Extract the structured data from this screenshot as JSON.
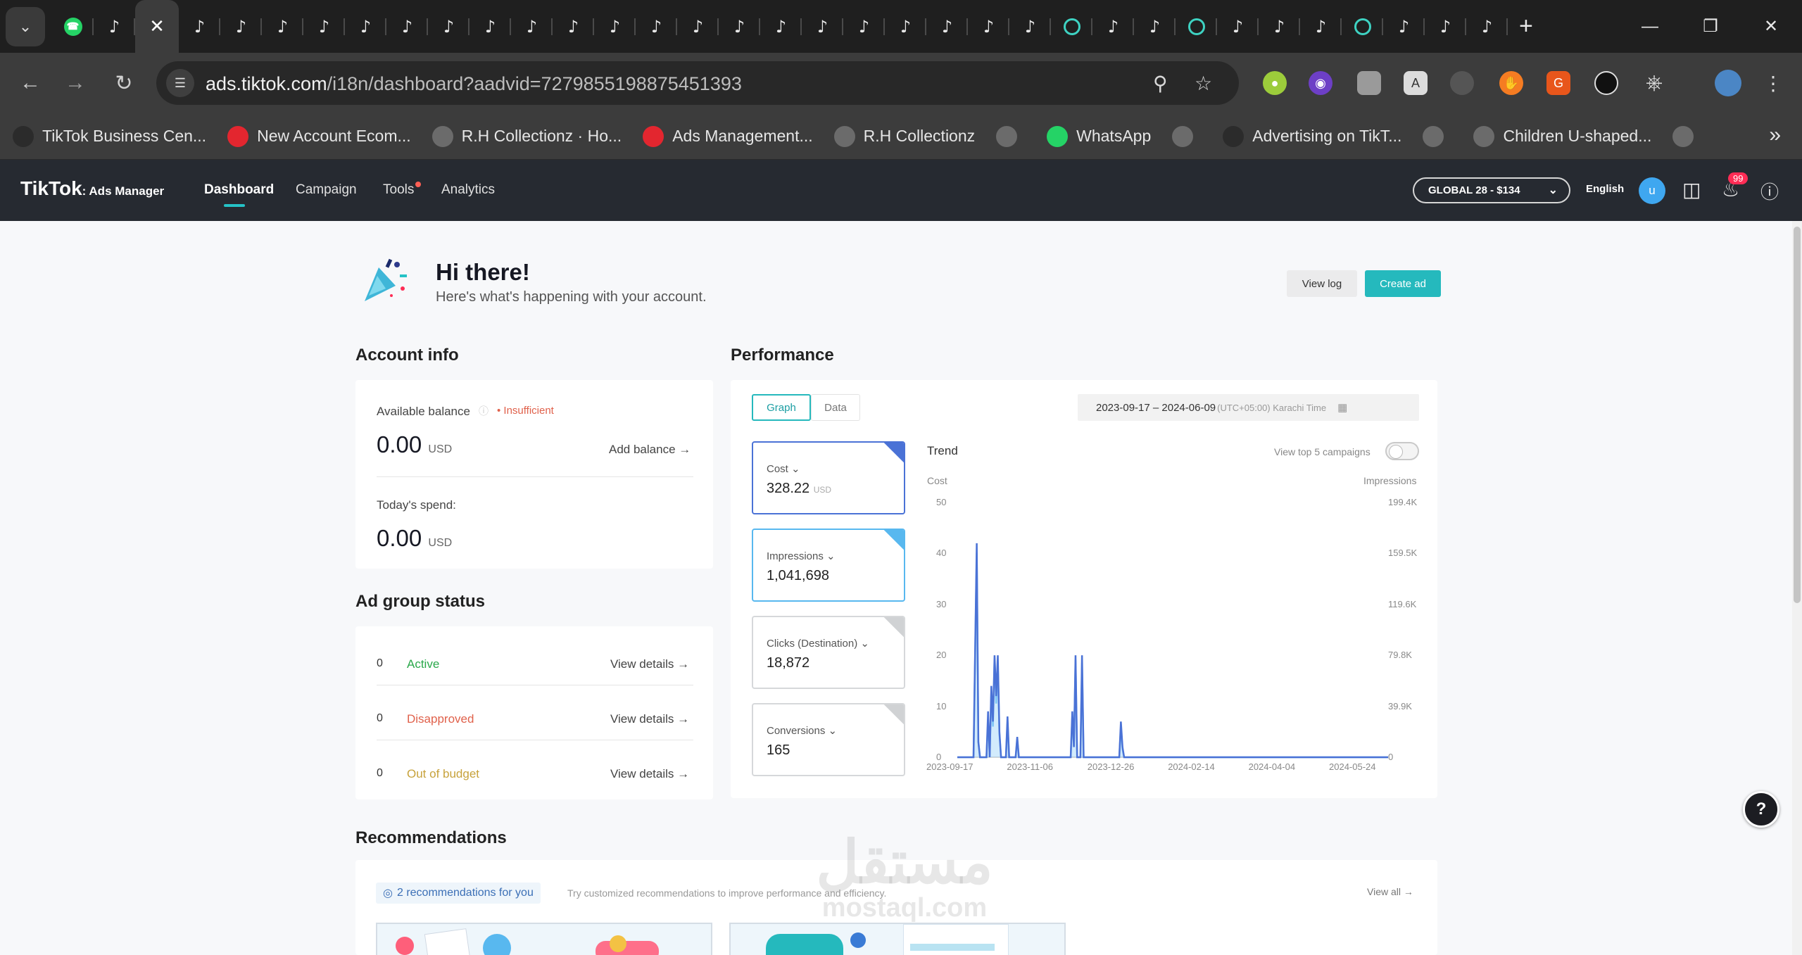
{
  "browser": {
    "tabs": [
      "whatsapp",
      "tiktok",
      "close",
      "tiktok",
      "tiktok",
      "tiktok",
      "tiktok",
      "tiktok",
      "tiktok",
      "tiktok",
      "tiktok",
      "tiktok",
      "tiktok",
      "tiktok",
      "tiktok",
      "tiktok",
      "tiktok",
      "tiktok",
      "tiktok",
      "tiktok",
      "tiktok",
      "tiktok",
      "tiktok",
      "tiktok",
      "loading",
      "tiktok",
      "tiktok",
      "loading",
      "tiktok",
      "tiktok",
      "tiktok",
      "loading",
      "tiktok",
      "tiktok",
      "tiktok"
    ],
    "url_host": "ads.tiktok.com",
    "url_path": "/i18n/dashboard?aadvid=7279855198875451393",
    "bookmarks": [
      {
        "label": "TikTok Business Cen...",
        "icon": "tiktok-icon",
        "color": "#2b2b2b"
      },
      {
        "label": "New Account Ecom...",
        "icon": "target-icon",
        "color": "#e3262f"
      },
      {
        "label": "R.H Collectionz · Ho...",
        "icon": "globe-icon",
        "color": "#6b6b6b"
      },
      {
        "label": "Ads Management...",
        "icon": "target-icon",
        "color": "#e3262f"
      },
      {
        "label": "R.H Collectionz",
        "icon": "globe-icon",
        "color": "#6b6b6b"
      },
      {
        "label": "",
        "icon": "globe-icon",
        "color": "#6b6b6b"
      },
      {
        "label": "WhatsApp",
        "icon": "whatsapp-icon",
        "color": "#25d366"
      },
      {
        "label": "",
        "icon": "globe-icon",
        "color": "#6b6b6b"
      },
      {
        "label": "Advertising on TikT...",
        "icon": "tiktok-icon",
        "color": "#2b2b2b"
      },
      {
        "label": "",
        "icon": "globe-icon",
        "color": "#6b6b6b"
      },
      {
        "label": "Children U-shaped...",
        "icon": "globe-icon",
        "color": "#6b6b6b"
      },
      {
        "label": "",
        "icon": "globe-icon",
        "color": "#6b6b6b"
      }
    ]
  },
  "header": {
    "logo": "TikTok",
    "logo_sub": ": Ads Manager",
    "nav": [
      "Dashboard",
      "Campaign",
      "Tools",
      "Analytics"
    ],
    "account": "GLOBAL 28 - $134",
    "language": "English",
    "avatar": "u",
    "notification_count": "99"
  },
  "greeting": {
    "title": "Hi there!",
    "subtitle": "Here's what's happening with your account.",
    "view_log": "View log",
    "create_ad": "Create ad"
  },
  "account_info": {
    "title": "Account info",
    "balance_label": "Available balance",
    "insufficient": "• Insufficient",
    "balance": "0.00",
    "currency": "USD",
    "add_balance": "Add balance →",
    "spend_label": "Today's spend:",
    "spend": "0.00"
  },
  "ad_group_status": {
    "title": "Ad group status",
    "rows": [
      {
        "count": "0",
        "label": "Active",
        "color": "#2aa84a",
        "link": "View details →"
      },
      {
        "count": "0",
        "label": "Disapproved",
        "color": "#e0614b",
        "link": "View details →"
      },
      {
        "count": "0",
        "label": "Out of budget",
        "color": "#c7a23b",
        "link": "View details →"
      }
    ]
  },
  "performance": {
    "title": "Performance",
    "tab_graph": "Graph",
    "tab_data": "Data",
    "date_range": "2023-09-17   –   2024-06-09",
    "timezone": "(UTC+05:00) Karachi Time",
    "metrics": [
      {
        "label": "Cost ⌄",
        "value": "328.22",
        "unit": "USD",
        "accent": "#4a72d6"
      },
      {
        "label": "Impressions ⌄",
        "value": "1,041,698",
        "unit": "",
        "accent": "#58b8ef"
      },
      {
        "label": "Clicks (Destination) ⌄",
        "value": "18,872",
        "unit": "",
        "accent": "#d0d2d4"
      },
      {
        "label": "Conversions ⌄",
        "value": "165",
        "unit": "",
        "accent": "#d0d2d4"
      }
    ],
    "trend_title": "Trend",
    "toggle_label": "View top 5 campaigns"
  },
  "chart_data": {
    "type": "line",
    "xlabel": "",
    "y_left_label": "Cost",
    "y_right_label": "Impressions",
    "x_ticks": [
      "2023-09-17",
      "2023-11-06",
      "2023-12-26",
      "2024-02-14",
      "2024-04-04",
      "2024-05-24"
    ],
    "y_left_ticks": [
      "50",
      "40",
      "30",
      "20",
      "10",
      "0"
    ],
    "y_right_ticks": [
      "199.4K",
      "159.5K",
      "119.6K",
      "79.8K",
      "39.9K",
      "0"
    ],
    "ylim_left": [
      0,
      50
    ],
    "ylim_right": [
      0,
      199400
    ],
    "x_day_range": [
      0,
      266
    ],
    "series": [
      {
        "name": "Cost",
        "color": "#4a72d6",
        "points": [
          [
            0,
            0
          ],
          [
            10,
            0
          ],
          [
            12,
            42
          ],
          [
            13,
            3
          ],
          [
            14,
            0
          ],
          [
            18,
            0
          ],
          [
            19,
            9
          ],
          [
            20,
            0
          ],
          [
            21,
            14
          ],
          [
            22,
            7
          ],
          [
            23,
            20
          ],
          [
            24,
            12
          ],
          [
            25,
            20
          ],
          [
            26,
            5
          ],
          [
            27,
            0
          ],
          [
            30,
            0
          ],
          [
            31,
            8
          ],
          [
            32,
            0
          ],
          [
            36,
            0
          ],
          [
            37,
            4
          ],
          [
            38,
            0
          ],
          [
            70,
            0
          ],
          [
            71,
            9
          ],
          [
            72,
            2
          ],
          [
            73,
            20
          ],
          [
            74,
            0
          ],
          [
            76,
            0
          ],
          [
            77,
            20
          ],
          [
            78,
            0
          ],
          [
            100,
            0
          ],
          [
            101,
            7
          ],
          [
            102,
            2
          ],
          [
            103,
            0
          ],
          [
            266,
            0
          ]
        ]
      },
      {
        "name": "Impressions",
        "color": "#7fc6f5",
        "points": [
          [
            0,
            0
          ],
          [
            10,
            0
          ],
          [
            12,
            160000
          ],
          [
            13,
            12000
          ],
          [
            14,
            0
          ],
          [
            18,
            0
          ],
          [
            19,
            30000
          ],
          [
            20,
            0
          ],
          [
            21,
            52000
          ],
          [
            22,
            24000
          ],
          [
            23,
            78000
          ],
          [
            24,
            42000
          ],
          [
            25,
            74000
          ],
          [
            26,
            18000
          ],
          [
            27,
            0
          ],
          [
            30,
            0
          ],
          [
            31,
            28000
          ],
          [
            32,
            0
          ],
          [
            36,
            0
          ],
          [
            37,
            14000
          ],
          [
            38,
            0
          ],
          [
            70,
            0
          ],
          [
            71,
            32000
          ],
          [
            72,
            8000
          ],
          [
            73,
            76000
          ],
          [
            74,
            0
          ],
          [
            76,
            0
          ],
          [
            77,
            74000
          ],
          [
            78,
            0
          ],
          [
            100,
            0
          ],
          [
            101,
            24000
          ],
          [
            102,
            6000
          ],
          [
            103,
            0
          ],
          [
            266,
            0
          ]
        ]
      }
    ]
  },
  "recommendations": {
    "title": "Recommendations",
    "pill": "2 recommendations for you",
    "desc": "Try customized recommendations to improve performance and efficiency.",
    "view_all": "View all →"
  }
}
